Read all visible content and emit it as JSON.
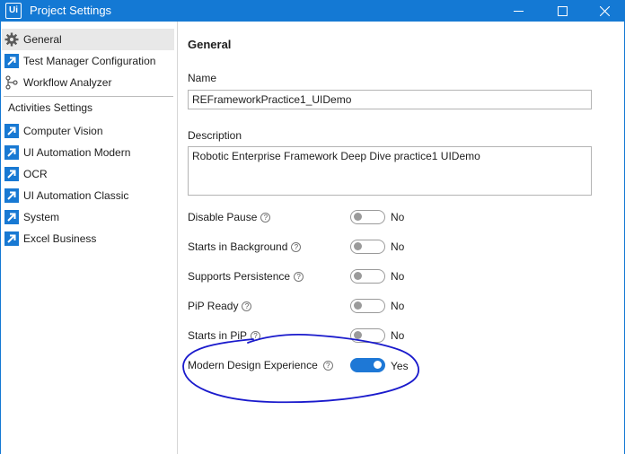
{
  "window": {
    "logo": "Ui",
    "title": "Project Settings"
  },
  "sidebar": {
    "items": [
      {
        "label": "General",
        "icon": "gear-icon"
      },
      {
        "label": "Test Manager Configuration",
        "icon": "activity-package-icon"
      },
      {
        "label": "Workflow Analyzer",
        "icon": "workflow-analyzer-icon"
      }
    ],
    "section_title": "Activities Settings",
    "activities": [
      {
        "label": "Computer Vision",
        "icon": "activity-package-icon"
      },
      {
        "label": "UI Automation Modern",
        "icon": "activity-package-icon"
      },
      {
        "label": "OCR",
        "icon": "activity-package-icon"
      },
      {
        "label": "UI Automation Classic",
        "icon": "activity-package-icon"
      },
      {
        "label": "System",
        "icon": "activity-package-icon"
      },
      {
        "label": "Excel Business",
        "icon": "activity-package-icon"
      }
    ]
  },
  "main": {
    "title": "General",
    "name_label": "Name",
    "name_value": "REFrameworkPractice1_UIDemo",
    "description_label": "Description",
    "description_value": "Robotic Enterprise Framework Deep Dive practice1 UIDemo",
    "settings": [
      {
        "label": "Disable Pause",
        "value": "No",
        "on": false
      },
      {
        "label": "Starts in Background",
        "value": "No",
        "on": false
      },
      {
        "label": "Supports Persistence",
        "value": "No",
        "on": false
      },
      {
        "label": "PiP Ready",
        "value": "No",
        "on": false
      },
      {
        "label": "Starts in PiP",
        "value": "No",
        "on": false
      },
      {
        "label": "Modern Design Experience",
        "value": "Yes",
        "on": true
      }
    ],
    "help_glyph": "?"
  },
  "colors": {
    "titlebar": "#1479d4",
    "accent": "#1e78d6",
    "highlight_ink": "#1a1acc"
  }
}
